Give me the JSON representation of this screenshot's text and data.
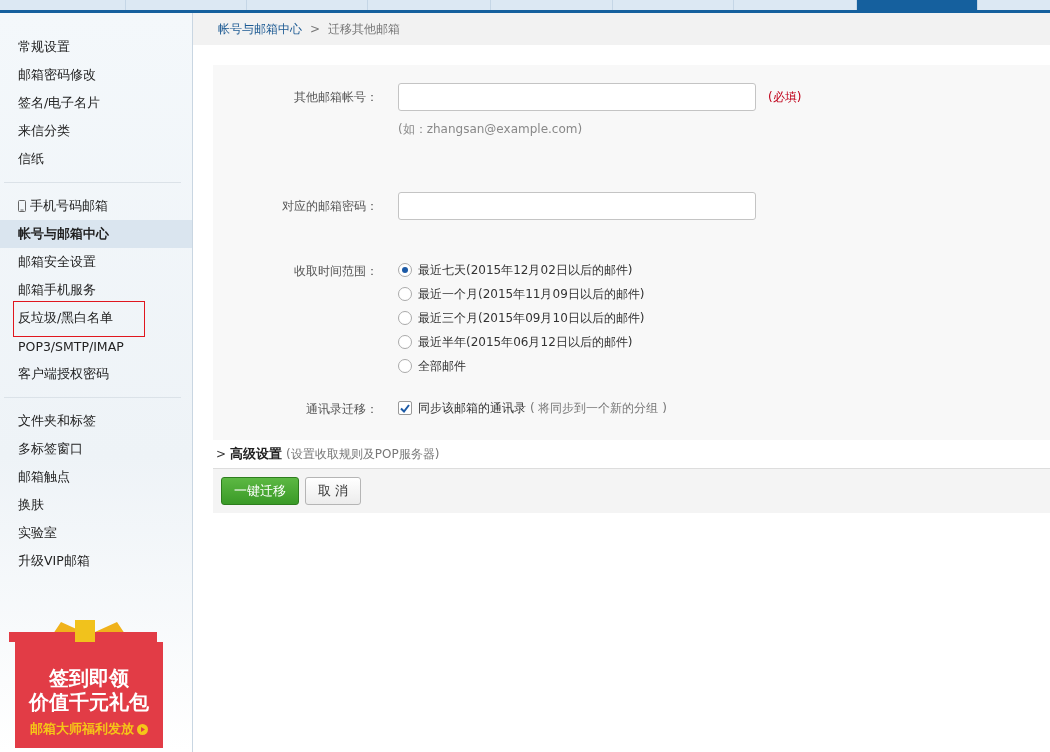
{
  "top_tabs": [
    {
      "selected": false
    },
    {
      "selected": false
    },
    {
      "selected": false
    },
    {
      "selected": false
    },
    {
      "selected": false
    },
    {
      "selected": false
    },
    {
      "selected": false
    },
    {
      "selected": true
    },
    {
      "selected": false
    }
  ],
  "sidebar": {
    "groups": [
      {
        "items": [
          {
            "label": "常规设置",
            "selected": false,
            "outlined": false
          },
          {
            "label": "邮箱密码修改",
            "selected": false,
            "outlined": false
          },
          {
            "label": "签名/电子名片",
            "selected": false,
            "outlined": false
          },
          {
            "label": "来信分类",
            "selected": false,
            "outlined": false
          },
          {
            "label": "信纸",
            "selected": false,
            "outlined": false
          }
        ]
      },
      {
        "items": [
          {
            "label": "手机号码邮箱",
            "kind": "phone",
            "selected": false,
            "outlined": false
          },
          {
            "label": "帐号与邮箱中心",
            "selected": true,
            "outlined": false
          },
          {
            "label": "邮箱安全设置",
            "selected": false,
            "outlined": false
          },
          {
            "label": "邮箱手机服务",
            "selected": false,
            "outlined": false
          },
          {
            "label": "反垃圾/黑白名单",
            "selected": false,
            "outlined": true
          },
          {
            "label": "POP3/SMTP/IMAP",
            "selected": false,
            "outlined": false
          },
          {
            "label": "客户端授权密码",
            "selected": false,
            "outlined": false
          }
        ]
      },
      {
        "items": [
          {
            "label": "文件夹和标签",
            "selected": false,
            "outlined": false
          },
          {
            "label": "多标签窗口",
            "selected": false,
            "outlined": false
          },
          {
            "label": "邮箱触点",
            "selected": false,
            "outlined": false
          },
          {
            "label": "换肤",
            "selected": false,
            "outlined": false
          },
          {
            "label": "实验室",
            "selected": false,
            "outlined": false
          },
          {
            "label": "升级VIP邮箱",
            "selected": false,
            "outlined": false
          }
        ]
      }
    ],
    "promo": {
      "line_1": "签到即领",
      "line_2": "价值千元礼包",
      "link": "邮箱大师福利发放"
    }
  },
  "breadcrumb": {
    "parent": "帐号与邮箱中心",
    "separator": ">",
    "current": "迁移其他邮箱"
  },
  "form": {
    "account": {
      "label": "其他邮箱帐号：",
      "required": "(必填)",
      "hint": "(如：zhangsan@example.com)"
    },
    "password": {
      "label": "对应的邮箱密码："
    },
    "range": {
      "label": "收取时间范围：",
      "options": [
        {
          "label": "最近七天(2015年12月02日以后的邮件)",
          "selected": true
        },
        {
          "label": "最近一个月(2015年11月09日以后的邮件)",
          "selected": false
        },
        {
          "label": "最近三个月(2015年09月10日以后的邮件)",
          "selected": false
        },
        {
          "label": "最近半年(2015年06月12日以后的邮件)",
          "selected": false
        },
        {
          "label": "全部邮件",
          "selected": false
        }
      ]
    },
    "contacts": {
      "label": "通讯录迁移：",
      "option": "同步该邮箱的通讯录",
      "note": "( 将同步到一个新的分组 )",
      "checked": true
    }
  },
  "advanced": {
    "arrow": ">",
    "title": "高级设置",
    "note": "(设置收取规则及POP服务器)",
    "expanded": false
  },
  "buttons": [
    {
      "label": "一键迁移",
      "kind": "primary"
    },
    {
      "label": "取 消",
      "kind": "secondary"
    }
  ]
}
